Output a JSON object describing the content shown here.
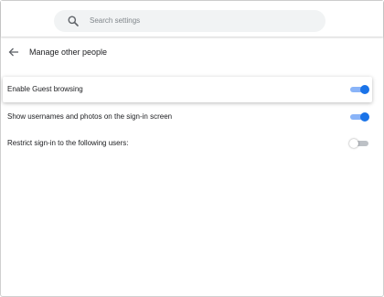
{
  "search": {
    "placeholder": "Search settings",
    "icon": "search-icon"
  },
  "header": {
    "back_icon": "arrow-back-icon",
    "title": "Manage other people"
  },
  "settings": [
    {
      "label": "Enable Guest browsing",
      "enabled": true,
      "highlighted": true
    },
    {
      "label": "Show usernames and photos on the sign-in screen",
      "enabled": true,
      "highlighted": false
    },
    {
      "label": "Restrict sign-in to the following users:",
      "enabled": false,
      "highlighted": false
    }
  ],
  "colors": {
    "accent": "#1a73e8",
    "accent_track": "#8ab4f8",
    "off_track": "#bdc1c6",
    "search_bg": "#f1f3f4"
  }
}
